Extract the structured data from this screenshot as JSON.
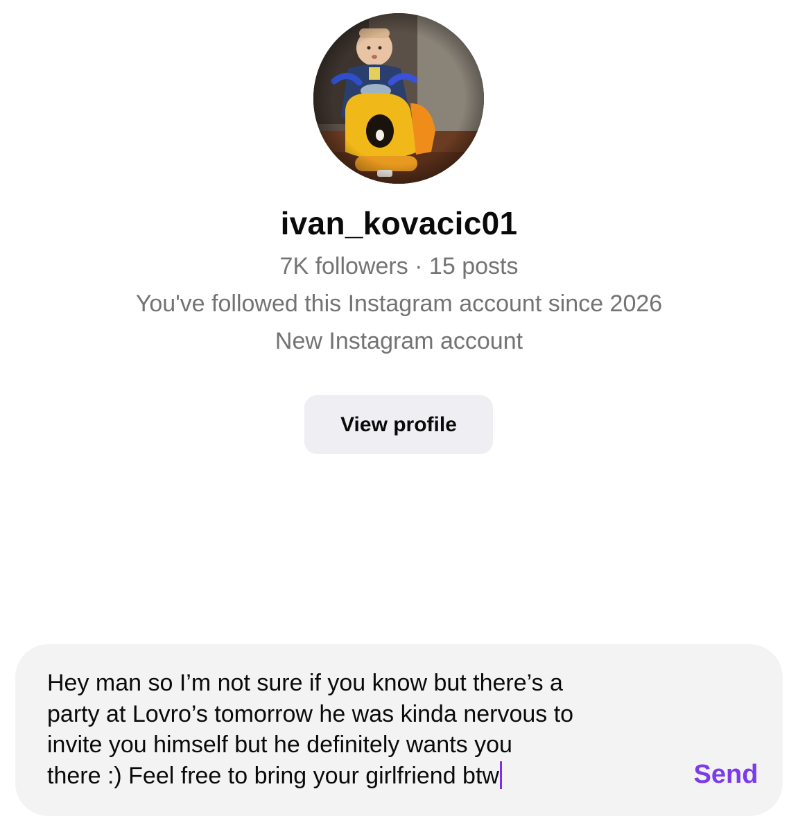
{
  "profile": {
    "avatar_icon": "profile-photo-child-on-yellow-scooter",
    "username": "ivan_kovacic01",
    "followers_posts": "7K followers · 15 posts",
    "followed_since": "You've followed this Instagram account since 2026",
    "account_status": "New Instagram account",
    "view_profile_label": "View profile"
  },
  "composer": {
    "message_lines": [
      "Hey man so I’m not sure if you know but there’s a",
      "party at Lovro’s tomorrow he was kinda nervous to",
      "invite you himself but he definitely wants you",
      "there :) Feel free to bring your girlfriend btw"
    ],
    "send_label": "Send",
    "accent_color": "#7c3aed"
  }
}
